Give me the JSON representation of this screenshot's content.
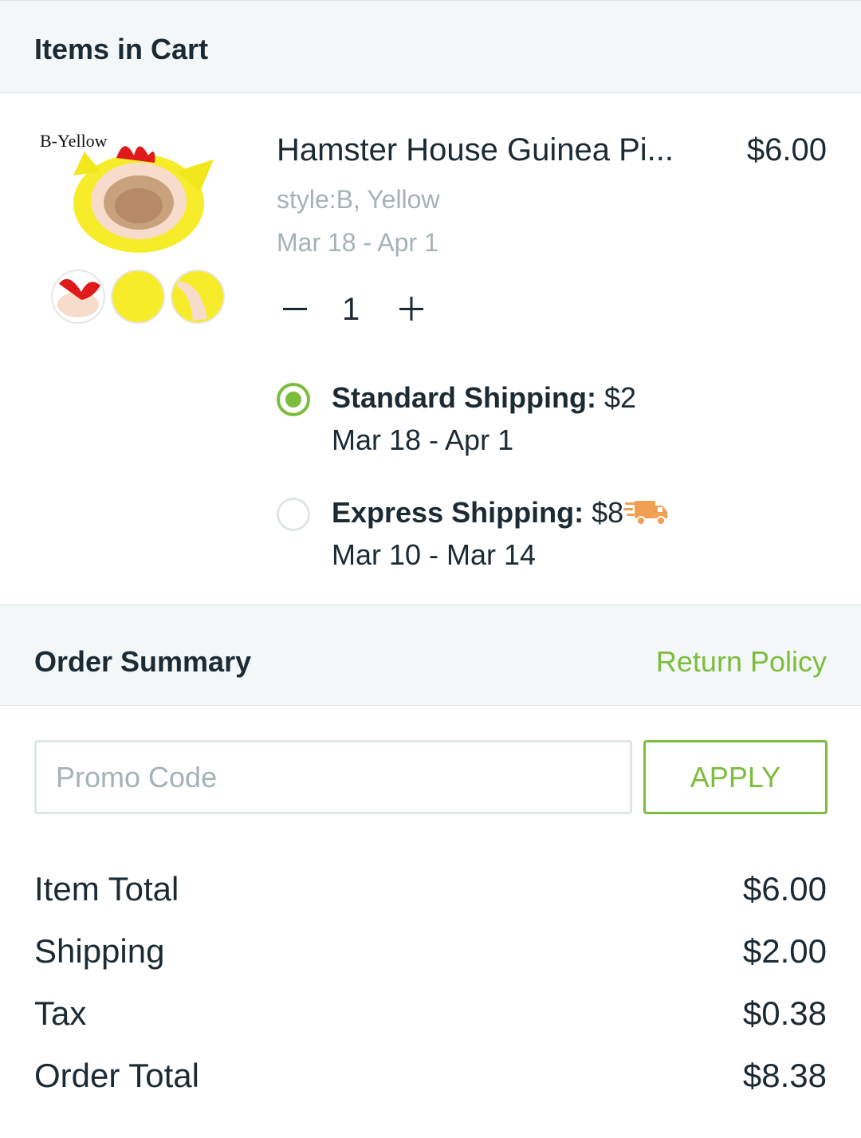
{
  "cart_header": {
    "title": "Items in Cart"
  },
  "product": {
    "thumb_label": "B-Yellow",
    "name": "Hamster House Guinea Pi...",
    "price": "$6.00",
    "variant": "style:B, Yellow",
    "delivery_dates": "Mar 18 - Apr 1",
    "quantity": "1"
  },
  "shipping": {
    "standard": {
      "label": "Standard Shipping:",
      "price": "$2",
      "dates": "Mar 18 - Apr 1",
      "selected": true
    },
    "express": {
      "label": "Express Shipping:",
      "price": "$8",
      "dates": "Mar 10 - Mar 14",
      "icon": "delivery-truck-icon",
      "selected": false
    }
  },
  "summary_header": {
    "title": "Order Summary",
    "return_policy": "Return Policy"
  },
  "promo": {
    "placeholder": "Promo Code",
    "value": "",
    "apply_label": "APPLY"
  },
  "totals": {
    "item_total": {
      "label": "Item Total",
      "value": "$6.00"
    },
    "shipping": {
      "label": "Shipping",
      "value": "$2.00"
    },
    "tax": {
      "label": "Tax",
      "value": "$0.38"
    },
    "order_total": {
      "label": "Order Total",
      "value": "$8.38"
    }
  },
  "colors": {
    "accent": "#7cbd3b",
    "header_bg": "#f3f7f8",
    "muted_text": "#a6b2b6",
    "text": "#1b2a33",
    "truck": "#f0a050"
  }
}
